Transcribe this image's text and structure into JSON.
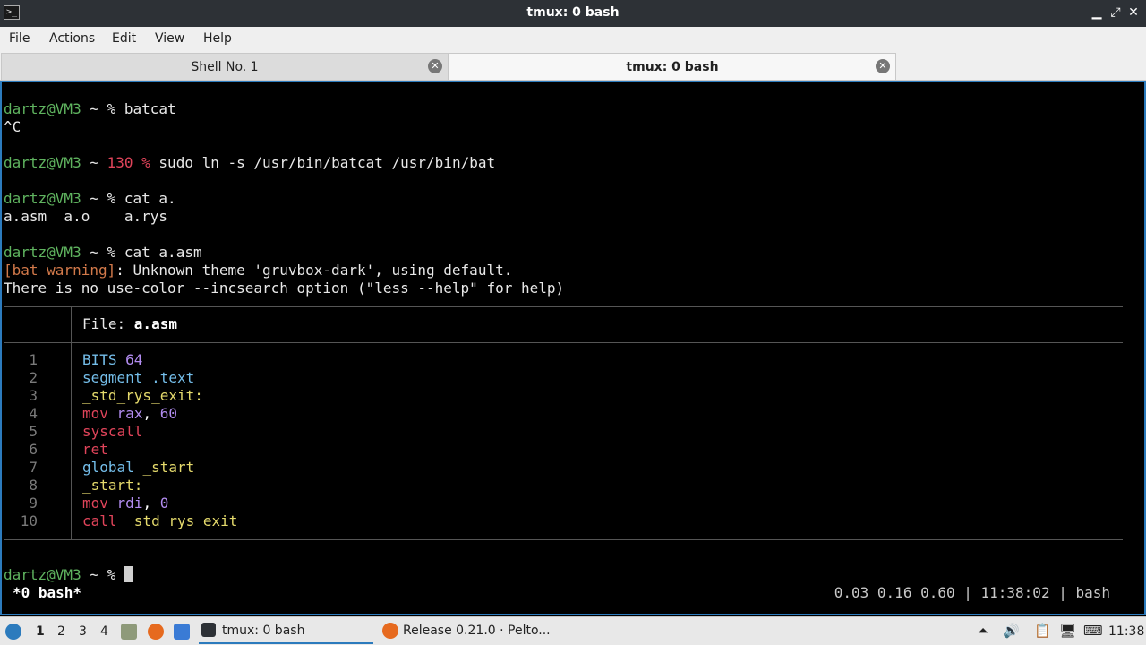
{
  "window": {
    "title": "tmux: 0 bash",
    "controls": [
      "minimize-icon",
      "restore-icon",
      "close-icon"
    ]
  },
  "menu": [
    "File",
    "Actions",
    "Edit",
    "View",
    "Help"
  ],
  "tabs": [
    {
      "label": "Shell No. 1",
      "active": false
    },
    {
      "label": "tmux: 0 bash",
      "active": true
    }
  ],
  "terminal": {
    "prompt_user": "dartz@VM3",
    "prompt_rest": " ~ ",
    "prompt_pct": "%",
    "lines": {
      "l1_cmd": "batcat",
      "l2": "^C",
      "l3_code": "130 %",
      "l3_cmd": "sudo ln -s /usr/bin/batcat /usr/bin/bat",
      "l4_cmd": "cat a.",
      "l5": "a.asm  a.o    a.rys",
      "l6_cmd": "cat a.asm",
      "l7_tag": "[bat warning]",
      "l7_msg": ": Unknown theme 'gruvbox-dark', using default.",
      "l8": "There is no use-color --incsearch option (\"less --help\" for help)"
    },
    "file_label": "File: ",
    "file_name": "a.asm",
    "code": [
      {
        "n": "1",
        "parts": [
          [
            "BITS",
            "blue"
          ],
          [
            " ",
            "white"
          ],
          [
            "64",
            "purple"
          ]
        ]
      },
      {
        "n": "2",
        "parts": [
          [
            "segment",
            "blue"
          ],
          [
            " ",
            "white"
          ],
          [
            ".text",
            "blue"
          ]
        ]
      },
      {
        "n": "3",
        "parts": [
          [
            "_std_rys_exit:",
            "yellow"
          ]
        ]
      },
      {
        "n": "4",
        "parts": [
          [
            "mov",
            "red"
          ],
          [
            " ",
            "white"
          ],
          [
            "rax",
            "purple"
          ],
          [
            ", ",
            "white"
          ],
          [
            "60",
            "purple"
          ]
        ]
      },
      {
        "n": "5",
        "parts": [
          [
            "syscall",
            "red"
          ]
        ]
      },
      {
        "n": "6",
        "parts": [
          [
            "ret",
            "red"
          ]
        ]
      },
      {
        "n": "7",
        "parts": [
          [
            "global",
            "blue"
          ],
          [
            " ",
            "white"
          ],
          [
            "_start",
            "yellow"
          ]
        ]
      },
      {
        "n": "8",
        "parts": [
          [
            "_start:",
            "yellow"
          ]
        ]
      },
      {
        "n": "9",
        "parts": [
          [
            "mov",
            "red"
          ],
          [
            " ",
            "white"
          ],
          [
            "rdi",
            "purple"
          ],
          [
            ", ",
            "white"
          ],
          [
            "0",
            "purple"
          ]
        ]
      },
      {
        "n": "10",
        "parts": [
          [
            "call",
            "red"
          ],
          [
            " ",
            "white"
          ],
          [
            "_std_rys_exit",
            "yellow"
          ]
        ]
      }
    ],
    "status_left": "*0 bash*",
    "status_right": "0.03 0.16 0.60 | 11:38:02 | bash"
  },
  "taskbar": {
    "workspaces": [
      "1",
      "2",
      "3",
      "4"
    ],
    "tasks": [
      {
        "label": "tmux: 0 bash",
        "active": true
      },
      {
        "label": "Release 0.21.0 · Pelto...",
        "active": false
      }
    ],
    "clock": "11:38"
  },
  "colors": {
    "accent": "#2c7bbd",
    "prompt_green": "#5fb35f",
    "error_red": "#e0445a"
  }
}
